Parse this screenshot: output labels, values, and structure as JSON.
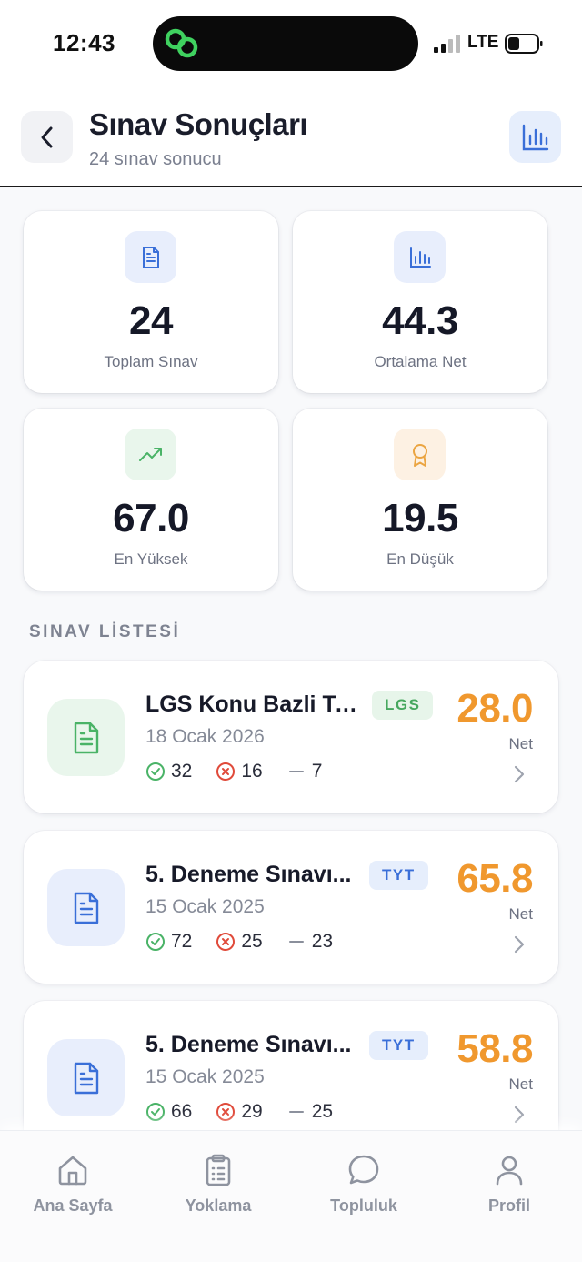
{
  "status_bar": {
    "time": "12:43",
    "network": "LTE"
  },
  "header": {
    "title": "Sınav Sonuçları",
    "subtitle": "24 sınav sonucu"
  },
  "stats": [
    {
      "value": "24",
      "label": "Toplam Sınav",
      "icon": "document-icon",
      "icon_bg": "#e8eefc",
      "icon_color": "#3a6fd8"
    },
    {
      "value": "44.3",
      "label": "Ortalama Net",
      "icon": "bar-chart-icon",
      "icon_bg": "#e8eefc",
      "icon_color": "#3a6fd8"
    },
    {
      "value": "67.0",
      "label": "En Yüksek",
      "icon": "trending-up-icon",
      "icon_bg": "#e9f6ec",
      "icon_color": "#4ab367"
    },
    {
      "value": "19.5",
      "label": "En Düşük",
      "icon": "award-icon",
      "icon_bg": "#fdf1e3",
      "icon_color": "#eba542"
    }
  ],
  "section_title": "SINAV LİSTESİ",
  "exams": [
    {
      "title": "LGS Konu Bazli Te...",
      "badge": "LGS",
      "date": "18 Ocak 2026",
      "correct": "32",
      "wrong": "16",
      "empty": "7",
      "net": "28.0",
      "net_label": "Net",
      "icon_bg": "#e9f6ec",
      "icon_color": "#4ab367",
      "badge_bg": "#e7f5ea",
      "badge_color": "#47a85f"
    },
    {
      "title": "5. Deneme Sınavı...",
      "badge": "TYT",
      "date": "15 Ocak 2025",
      "correct": "72",
      "wrong": "25",
      "empty": "23",
      "net": "65.8",
      "net_label": "Net",
      "icon_bg": "#e8eefc",
      "icon_color": "#3a6fd8",
      "badge_bg": "#e6eefc",
      "badge_color": "#3a6fd8"
    },
    {
      "title": "5. Deneme Sınavı...",
      "badge": "TYT",
      "date": "15 Ocak 2025",
      "correct": "66",
      "wrong": "29",
      "empty": "25",
      "net": "58.8",
      "net_label": "Net",
      "icon_bg": "#e8eefc",
      "icon_color": "#3a6fd8",
      "badge_bg": "#e6eefc",
      "badge_color": "#3a6fd8"
    }
  ],
  "nav": [
    {
      "label": "Ana Sayfa",
      "icon": "home-icon"
    },
    {
      "label": "Yoklama",
      "icon": "clipboard-icon"
    },
    {
      "label": "Topluluk",
      "icon": "chat-bubble-icon"
    },
    {
      "label": "Profil",
      "icon": "user-icon"
    }
  ],
  "colors": {
    "accent": "#3a6fd8",
    "net": "#f0982e",
    "correct": "#4ab367",
    "wrong": "#e04a3a"
  }
}
